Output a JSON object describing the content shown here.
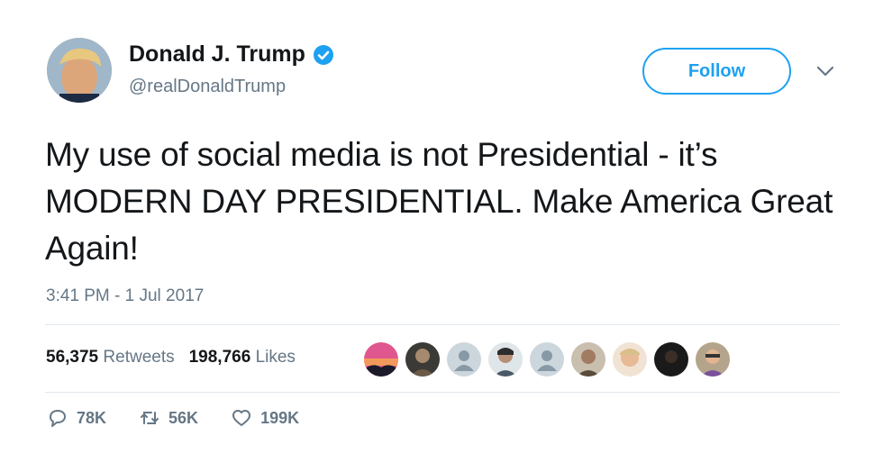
{
  "author": {
    "name": "Donald J. Trump",
    "handle": "@realDonaldTrump",
    "verified": true,
    "avatar_icon": "user-avatar-photo"
  },
  "follow_button": {
    "label": "Follow",
    "color": "#1da1f2"
  },
  "menu_icon": "chevron-down-icon",
  "tweet": {
    "text": "My use of social media is not Presidential - it’s MODERN DAY PRESIDENTIAL. Make America Great Again!",
    "timestamp": "3:41 PM - 1 Jul 2017"
  },
  "stats": {
    "retweets_count": "56,375",
    "retweets_label": "Retweets",
    "likes_count": "198,766",
    "likes_label": "Likes"
  },
  "liker_avatars": [
    "sunset-photo",
    "user-photo",
    "default-egg",
    "user-photo",
    "default-egg",
    "user-photo",
    "user-photo",
    "user-photo",
    "user-photo"
  ],
  "actions": {
    "reply_count": "78K",
    "retweet_count": "56K",
    "like_count": "199K"
  },
  "colors": {
    "text": "#14171a",
    "secondary": "#657786",
    "accent": "#1da1f2",
    "divider": "#e1e8ed"
  }
}
